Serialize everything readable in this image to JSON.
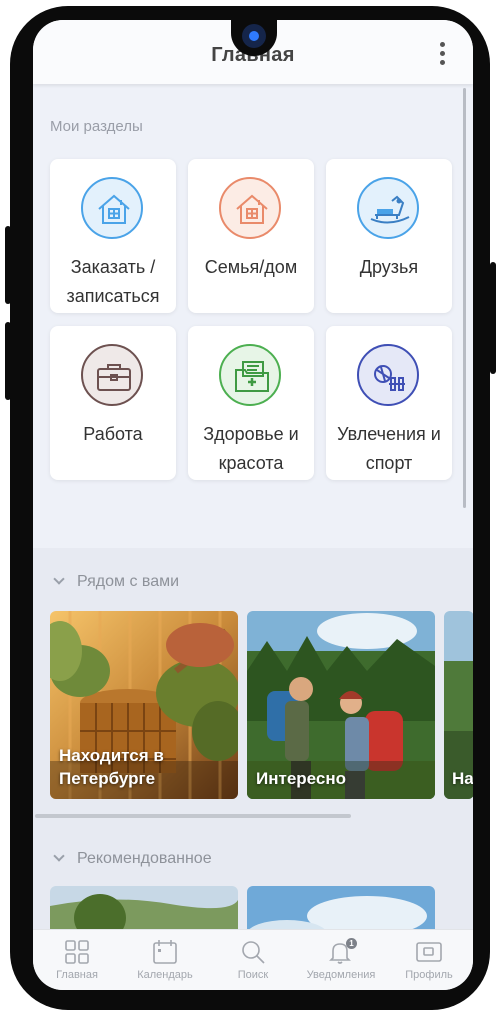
{
  "header": {
    "title": "Главная"
  },
  "sections": {
    "my_sections": {
      "title": "Мои разделы",
      "tiles": [
        {
          "label": "Заказать / записаться",
          "icon": "house-icon",
          "color": "#4aa3e8",
          "bg": "#e3f1fc"
        },
        {
          "label": "Семья/дом",
          "icon": "house-icon",
          "color": "#e98a6a",
          "bg": "#fcece5"
        },
        {
          "label": "Друзья",
          "icon": "rocking-horse-icon",
          "color": "#4aa3e8",
          "bg": "#e3f1fc"
        },
        {
          "label": "Работа",
          "icon": "briefcase-icon",
          "color": "#6d5150",
          "bg": "#efe9e8"
        },
        {
          "label": "Здоровье и красота",
          "icon": "medical-folder-icon",
          "color": "#4caf50",
          "bg": "#e7f5e7"
        },
        {
          "label": "Увлечения и спорт",
          "icon": "sports-icon",
          "color": "#3f4fb5",
          "bg": "#e5e8f7"
        }
      ]
    },
    "nearby": {
      "title": "Рядом с вами",
      "cards": [
        {
          "text": "Находится в Петербурге"
        },
        {
          "text": "Интересно"
        },
        {
          "text": "На Пе"
        }
      ]
    },
    "recommended": {
      "title": "Рекомендованное"
    }
  },
  "navbar": {
    "items": [
      {
        "label": "Главная",
        "icon": "grid-icon"
      },
      {
        "label": "Календарь",
        "icon": "calendar-icon"
      },
      {
        "label": "Поиск",
        "icon": "search-icon"
      },
      {
        "label": "Уведомления",
        "icon": "bell-icon",
        "badge": "1"
      },
      {
        "label": "Профиль",
        "icon": "profile-icon"
      }
    ]
  }
}
